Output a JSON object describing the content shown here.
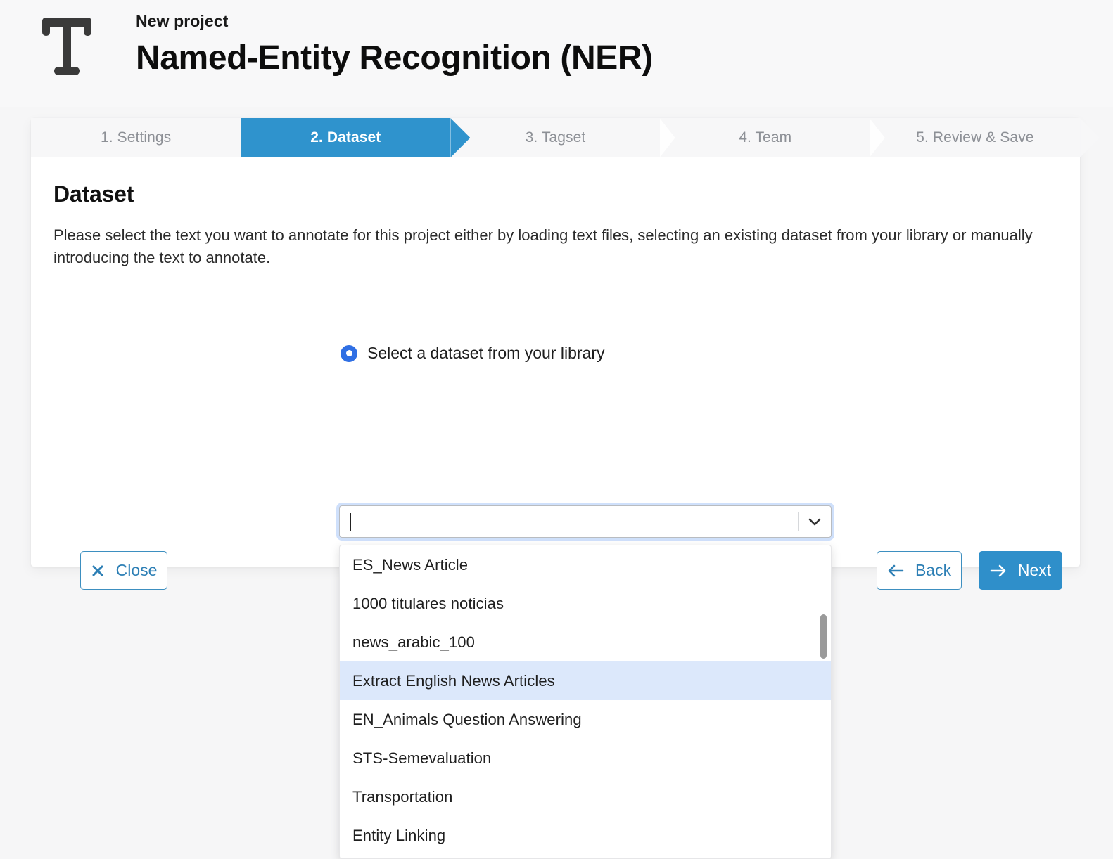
{
  "header": {
    "icon": "text-type-icon",
    "eyebrow": "New project",
    "title": "Named-Entity Recognition (NER)"
  },
  "steps": [
    {
      "label": "1. Settings",
      "active": false
    },
    {
      "label": "2. Dataset",
      "active": true
    },
    {
      "label": "3. Tagset",
      "active": false
    },
    {
      "label": "4. Team",
      "active": false
    },
    {
      "label": "5. Review & Save",
      "active": false
    }
  ],
  "main": {
    "section_title": "Dataset",
    "section_description": "Please select the text you want to annotate for this project either by loading text files, selecting an existing dataset from your library or manually introducing the text to annotate.",
    "radio": {
      "label": "Select a dataset from your library",
      "selected": true
    },
    "combobox": {
      "value": "",
      "placeholder": "",
      "arrow_icon": "chevron-down-icon",
      "expanded": true
    },
    "dropdown": {
      "options": [
        "ES_News Article",
        "1000 titulares noticias",
        "news_arabic_100",
        "Extract English News Articles",
        "EN_Animals Question Answering",
        "STS-Semevaluation",
        "Transportation",
        "Entity Linking"
      ],
      "highlighted_index": 3
    }
  },
  "footer": {
    "close": {
      "label": "Close",
      "icon": "close-x-icon"
    },
    "back": {
      "label": "Back",
      "icon": "arrow-left-icon"
    },
    "next": {
      "label": "Next",
      "icon": "arrow-right-icon"
    }
  },
  "colors": {
    "accent_blue": "#2f8fca",
    "active_step_blue": "#2f93cd",
    "radio_blue": "#2f6fe4",
    "highlight_row": "#dce8fb",
    "page_background": "#f6f6f7",
    "card_background": "#ffffff",
    "muted_text": "#8d9096"
  }
}
